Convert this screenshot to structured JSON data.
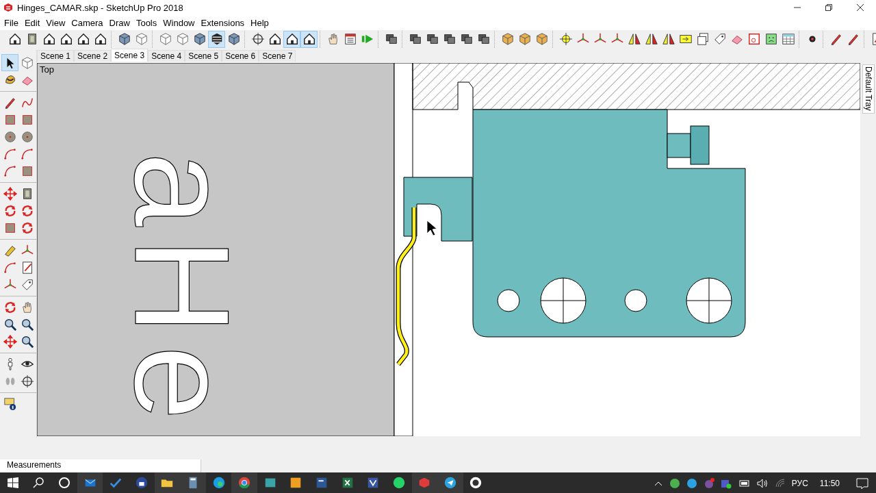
{
  "window": {
    "title": "Hinges_CAMAR.skp - SketchUp Pro 2018"
  },
  "menu": [
    "File",
    "Edit",
    "View",
    "Camera",
    "Draw",
    "Tools",
    "Window",
    "Extensions",
    "Help"
  ],
  "main_toolbar": [
    [
      {
        "kind": "house",
        "selected": false
      },
      {
        "kind": "box",
        "selected": false
      },
      {
        "kind": "house",
        "selected": false
      },
      {
        "kind": "house",
        "selected": false
      },
      {
        "kind": "house",
        "selected": false
      },
      {
        "kind": "house",
        "selected": false
      }
    ],
    [
      {
        "kind": "cube",
        "selected": false
      },
      {
        "kind": "wire-cube",
        "selected": false
      }
    ],
    [
      {
        "kind": "wire-cube",
        "selected": false
      },
      {
        "kind": "wire-cube",
        "selected": false
      },
      {
        "kind": "cube",
        "selected": false
      },
      {
        "kind": "stripes-cube",
        "selected": true
      },
      {
        "kind": "cube",
        "selected": false
      }
    ],
    [
      {
        "kind": "orbit",
        "selected": false
      },
      {
        "kind": "house",
        "selected": false
      },
      {
        "kind": "house",
        "selected": true
      },
      {
        "kind": "house",
        "selected": true
      }
    ],
    [
      {
        "kind": "hand",
        "selected": false
      },
      {
        "kind": "list",
        "selected": false
      },
      {
        "kind": "play",
        "selected": false
      }
    ],
    [
      {
        "kind": "layers",
        "selected": false
      }
    ],
    [
      {
        "kind": "layers",
        "selected": false
      },
      {
        "kind": "layers",
        "selected": false
      },
      {
        "kind": "layers",
        "selected": false
      },
      {
        "kind": "layers",
        "selected": false
      },
      {
        "kind": "layers",
        "selected": false
      }
    ],
    [
      {
        "kind": "solid",
        "selected": false
      },
      {
        "kind": "solid",
        "selected": false
      },
      {
        "kind": "solid",
        "selected": false
      }
    ],
    [
      {
        "kind": "sun",
        "selected": false
      },
      {
        "kind": "axis",
        "selected": false
      },
      {
        "kind": "axis",
        "selected": false
      },
      {
        "kind": "axis",
        "selected": false
      },
      {
        "kind": "mirror",
        "selected": false
      },
      {
        "kind": "mirror",
        "selected": false
      },
      {
        "kind": "mirror",
        "selected": false
      },
      {
        "kind": "arrow-box",
        "selected": false
      },
      {
        "kind": "copy",
        "selected": false
      },
      {
        "kind": "tag",
        "selected": false
      },
      {
        "kind": "eraser",
        "selected": false
      },
      {
        "kind": "window",
        "selected": false
      },
      {
        "kind": "face",
        "selected": false
      },
      {
        "kind": "table",
        "selected": false
      }
    ],
    [
      {
        "kind": "dot",
        "selected": false
      }
    ],
    [
      {
        "kind": "pencil",
        "selected": false
      },
      {
        "kind": "pencil",
        "selected": false
      }
    ],
    [
      {
        "kind": "doc",
        "selected": false
      }
    ]
  ],
  "scenes": [
    {
      "label": "Scene 1",
      "selected": false
    },
    {
      "label": "Scene 2",
      "selected": false
    },
    {
      "label": "Scene 3",
      "selected": true
    },
    {
      "label": "Scene 4",
      "selected": false
    },
    {
      "label": "Scene 5",
      "selected": false
    },
    {
      "label": "Scene 6",
      "selected": false
    },
    {
      "label": "Scene 7",
      "selected": false
    }
  ],
  "tool_palette": [
    [
      {
        "kind": "pointer",
        "selected": true
      },
      {
        "kind": "wire-cube",
        "selected": false
      },
      {
        "kind": "paint",
        "selected": false
      },
      {
        "kind": "eraser",
        "selected": false
      }
    ],
    [
      {
        "kind": "pencil",
        "selected": false
      },
      {
        "kind": "curve",
        "selected": false
      },
      {
        "kind": "square",
        "selected": false
      },
      {
        "kind": "square",
        "selected": false
      },
      {
        "kind": "circle",
        "selected": false
      },
      {
        "kind": "circle",
        "selected": false
      },
      {
        "kind": "arc",
        "selected": false
      },
      {
        "kind": "arc",
        "selected": false
      },
      {
        "kind": "arc",
        "selected": false
      },
      {
        "kind": "square",
        "selected": false
      }
    ],
    [
      {
        "kind": "move",
        "selected": false
      },
      {
        "kind": "box",
        "selected": false
      },
      {
        "kind": "rotate",
        "selected": false
      },
      {
        "kind": "rotate",
        "selected": false
      },
      {
        "kind": "square",
        "selected": false
      },
      {
        "kind": "rotate",
        "selected": false
      }
    ],
    [
      {
        "kind": "tape",
        "selected": false
      },
      {
        "kind": "axis",
        "selected": false
      },
      {
        "kind": "arc",
        "selected": false
      },
      {
        "kind": "doc",
        "selected": false
      },
      {
        "kind": "axis",
        "selected": false
      },
      {
        "kind": "tag",
        "selected": false
      }
    ],
    [
      {
        "kind": "rotate",
        "selected": false
      },
      {
        "kind": "hand",
        "selected": false
      },
      {
        "kind": "magnifier",
        "selected": false
      },
      {
        "kind": "magnifier",
        "selected": false
      },
      {
        "kind": "move",
        "selected": false
      },
      {
        "kind": "magnifier",
        "selected": false
      }
    ],
    [
      {
        "kind": "person",
        "selected": false
      },
      {
        "kind": "eye",
        "selected": false
      },
      {
        "kind": "footprint",
        "selected": false
      },
      {
        "kind": "orbit",
        "selected": false
      }
    ],
    [
      {
        "kind": "info",
        "selected": false
      }
    ]
  ],
  "viewport": {
    "view_label": "Top",
    "model_text": "aHe"
  },
  "tray": {
    "label": "Default Tray"
  },
  "status_bar": {
    "measurements_label": "Measurements"
  },
  "taskbar": {
    "apps": [
      {
        "kind": "mail",
        "open": true
      },
      {
        "kind": "check",
        "open": false
      },
      {
        "kind": "lock",
        "open": false
      },
      {
        "kind": "folder",
        "open": true
      },
      {
        "kind": "calculator",
        "open": true
      },
      {
        "kind": "edge",
        "open": false
      },
      {
        "kind": "chrome",
        "open": true
      },
      {
        "kind": "app",
        "open": false
      },
      {
        "kind": "outlook",
        "open": false
      },
      {
        "kind": "word",
        "open": false
      },
      {
        "kind": "excel",
        "open": false
      },
      {
        "kind": "visio",
        "open": false
      },
      {
        "kind": "whatsapp",
        "open": false
      },
      {
        "kind": "sketchup",
        "open": true
      },
      {
        "kind": "telegram",
        "open": true
      },
      {
        "kind": "github",
        "open": false
      }
    ],
    "language": "РУС",
    "time": "11:50"
  }
}
